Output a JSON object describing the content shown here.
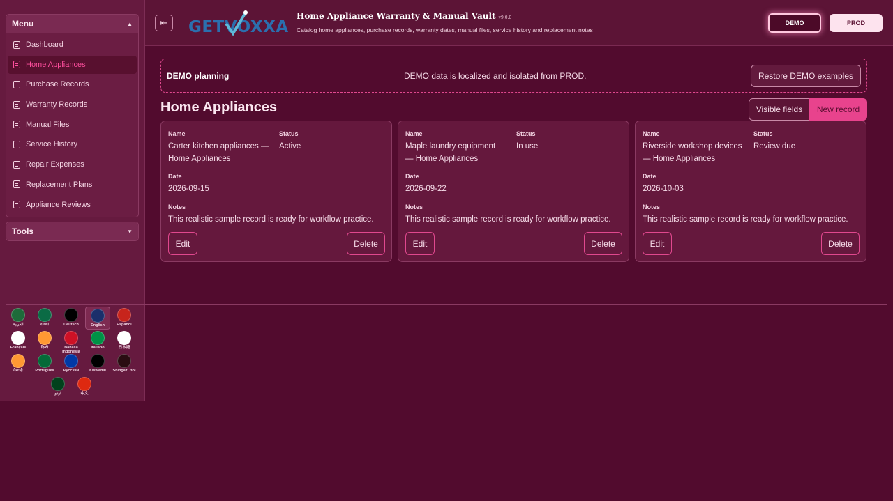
{
  "sidebar": {
    "menu_title": "Menu",
    "items": [
      {
        "label": "Dashboard"
      },
      {
        "label": "Home Appliances"
      },
      {
        "label": "Purchase Records"
      },
      {
        "label": "Warranty Records"
      },
      {
        "label": "Manual Files"
      },
      {
        "label": "Service History"
      },
      {
        "label": "Repair Expenses"
      },
      {
        "label": "Replacement Plans"
      },
      {
        "label": "Appliance Reviews"
      }
    ],
    "active_item": "Home Appliances",
    "tools_title": "Tools"
  },
  "languages": [
    {
      "name": "العربية",
      "flag": "#1e6b3a"
    },
    {
      "name": "বাংলা",
      "flag": "#0b6b45"
    },
    {
      "name": "Deutsch",
      "flag": "#000000"
    },
    {
      "name": "English",
      "flag": "#1b2f6b"
    },
    {
      "name": "Español",
      "flag": "#c7241c"
    },
    {
      "name": "Français",
      "flag": "#ffffff"
    },
    {
      "name": "हिन्दी",
      "flag": "#ff9933"
    },
    {
      "name": "Bahasa Indonesia",
      "flag": "#ce1126"
    },
    {
      "name": "Italiano",
      "flag": "#009246"
    },
    {
      "name": "日本語",
      "flag": "#ffffff"
    },
    {
      "name": "ਪੰਜਾਬੀ",
      "flag": "#ff9933"
    },
    {
      "name": "Português",
      "flag": "#046a38"
    },
    {
      "name": "Русский",
      "flag": "#0039a6"
    },
    {
      "name": "Kiswahili",
      "flag": "#000000"
    },
    {
      "name": "Shingazi Hoi",
      "flag": "#2a0d12"
    },
    {
      "name": "اردو",
      "flag": "#01411c"
    },
    {
      "name": "中文",
      "flag": "#de2910"
    }
  ],
  "selected_language": "English",
  "header": {
    "logo_text": "GETVOXXA",
    "title": "Home Appliance Warranty & Manual Vault",
    "version": "v9.0.0",
    "subtitle": "Catalog home appliances, purchase records, warranty dates, manual files, service history and replacement notes",
    "env_demo": "DEMO",
    "env_prod": "PROD"
  },
  "banner": {
    "title": "DEMO planning",
    "message": "DEMO data is localized and isolated from PROD.",
    "restore_label": "Restore DEMO examples"
  },
  "page": {
    "title": "Home Appliances",
    "visible_fields_label": "Visible fields",
    "new_record_label": "New record"
  },
  "labels": {
    "name": "Name",
    "status": "Status",
    "date": "Date",
    "notes": "Notes",
    "edit": "Edit",
    "delete": "Delete"
  },
  "records": [
    {
      "name_line1": "Carter kitchen appliances —",
      "name_line2": "Home Appliances",
      "status": "Active",
      "date": "2026-09-15",
      "notes": "This realistic sample record is ready for workflow practice."
    },
    {
      "name_line1": "Maple laundry equipment",
      "name_line2": "— Home Appliances",
      "status": "In use",
      "date": "2026-09-22",
      "notes": "This realistic sample record is ready for workflow practice."
    },
    {
      "name_line1": "Riverside workshop devices",
      "name_line2": "— Home Appliances",
      "status": "Review due",
      "date": "2026-10-03",
      "notes": "This realistic sample record is ready for workflow practice."
    }
  ],
  "colors": {
    "accent": "#e8438d",
    "background": "#520b2e",
    "sidebar": "#661a3f"
  }
}
